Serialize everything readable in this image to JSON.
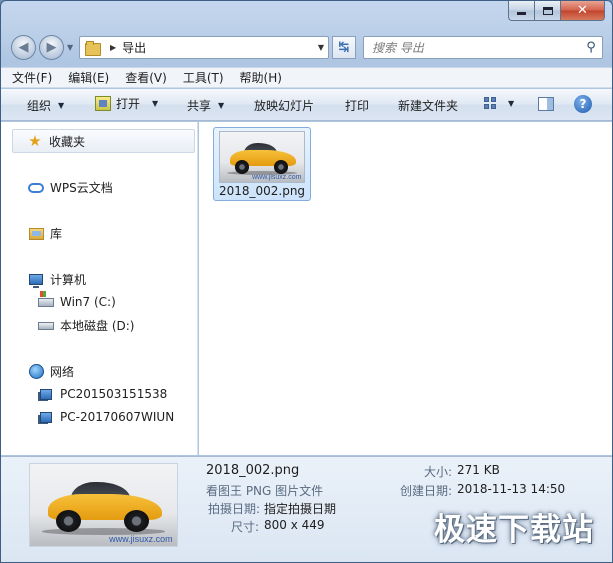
{
  "window": {
    "close_glyph": "✕"
  },
  "address": {
    "path": "导出",
    "search_placeholder": "搜索 导出"
  },
  "menu": {
    "items": [
      "文件(F)",
      "编辑(E)",
      "查看(V)",
      "工具(T)",
      "帮助(H)"
    ]
  },
  "toolbar": {
    "organize": "组织",
    "open": "打开",
    "share": "共享",
    "slideshow": "放映幻灯片",
    "print": "打印",
    "new_folder": "新建文件夹"
  },
  "nav": {
    "favorites": "收藏夹",
    "wps_cloud": "WPS云文档",
    "libraries": "库",
    "computer": "计算机",
    "drive_c": "Win7 (C:)",
    "drive_d": "本地磁盘 (D:)",
    "network": "网络",
    "net_pc1": "PC201503151538",
    "net_pc2": "PC-20170607WIUN"
  },
  "files": [
    {
      "name": "2018_002.png",
      "thumb_watermark": "www.jisuxz.com"
    }
  ],
  "details": {
    "filename": "2018_002.png",
    "type": "看图王 PNG 图片文件",
    "taken_label": "拍摄日期:",
    "taken_value": "指定拍摄日期",
    "dimensions_label": "尺寸:",
    "dimensions_value": "800 x 449",
    "size_label": "大小:",
    "size_value": "271 KB",
    "created_label": "创建日期:",
    "created_value": "2018-11-13 14:50",
    "thumb_watermark": "www.jisuxz.com"
  },
  "watermark": "极速下载站",
  "colors": {
    "accent": "#3c7fd0",
    "selection": "#cce3fb",
    "close_button": "#c0432b"
  }
}
